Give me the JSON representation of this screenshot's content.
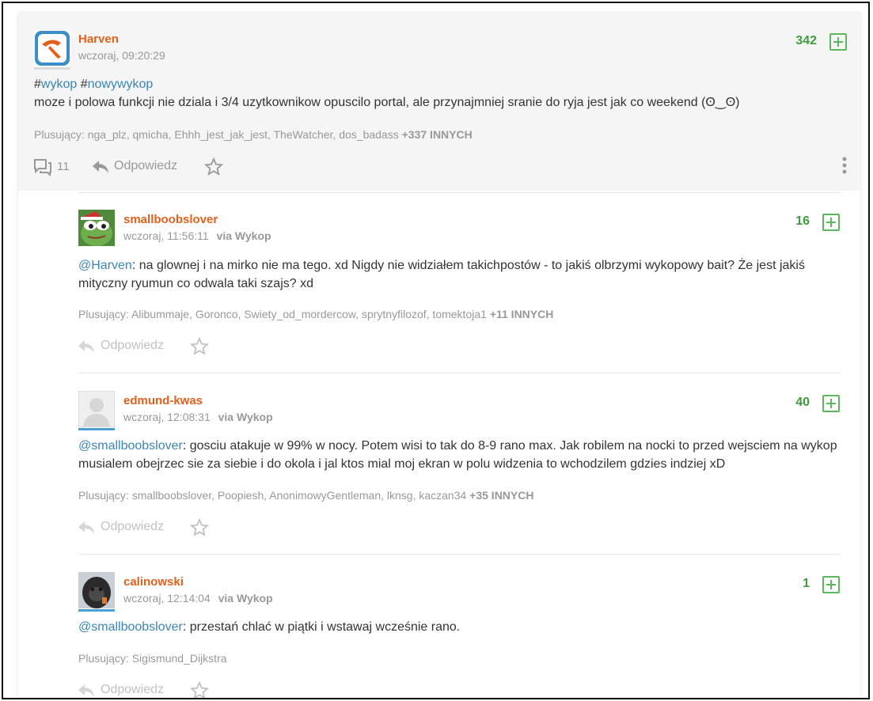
{
  "colors": {
    "username": "#e3601c",
    "link": "#3a86b8",
    "score": "#3e9d3e",
    "muted": "#999999"
  },
  "main": {
    "username": "Harven",
    "time": "wczoraj, 09:20:29",
    "score": "342",
    "tag1_hash": "#",
    "tag1": "wykop",
    "tag2_hash": "#",
    "tag2": "nowywykop",
    "text": "moze i polowa funkcji nie dziala i 3/4 uzytkownikow opuscilo portal, ale przynajmniej sranie do ryja jest jak co weekend (ʘ‿ʘ)",
    "voters_label": "Plusujący:",
    "voters": "nga_plz, qmicha, Ehhh_jest_jak_jest, TheWatcher, dos_badass",
    "voters_more": "+337 INNYCH",
    "comments_count": "11",
    "reply_label": "Odpowiedz",
    "avatar_icon": "wykop-logo-icon"
  },
  "comments": [
    {
      "username": "smallboobslover",
      "time": "wczoraj, 11:56:11",
      "via_label": "via",
      "via": "Wykop",
      "score": "16",
      "mention": "@Harven",
      "text": ": na glownej i na mirko nie ma tego. xd Nigdy nie widziałem takichpostów - to jakiś olbrzymi wykopowy bait? Że jest jakiś mityczny ryumun co odwala taki szajs? xd",
      "voters_label": "Plusujący:",
      "voters": "Alibummaje, Goronco, Swiety_od_mordercow, sprytnyfilozof, tomektoja1",
      "voters_more": "+11 INNYCH",
      "reply_label": "Odpowiedz",
      "avatar_icon": "frog-avatar-icon"
    },
    {
      "username": "edmund-kwas",
      "time": "wczoraj, 12:08:31",
      "via_label": "via",
      "via": "Wykop",
      "score": "40",
      "mention": "@smallboobslover",
      "text": ": gosciu atakuje w 99% w nocy. Potem wisi to tak do 8-9 rano max. Jak robilem na nocki to przed wejsciem na wykop musialem obejrzec sie za siebie i do okola i jal ktos mial moj ekran w polu widzenia to wchodzilem gdzies indziej xD",
      "voters_label": "Plusujący:",
      "voters": "smallboobslover, Poopiesh, AnonimowyGentleman, lknsg, kaczan34",
      "voters_more": "+35 INNYCH",
      "reply_label": "Odpowiedz",
      "avatar_icon": "default-user-avatar-icon"
    },
    {
      "username": "calinowski",
      "time": "wczoraj, 12:14:04",
      "via_label": "via",
      "via": "Wykop",
      "score": "1",
      "mention": "@smallboobslover",
      "text": ": przestań chlać w piątki i wstawaj wcześnie rano.",
      "voters_label": "Plusujący:",
      "voters": "Sigismund_Dijkstra",
      "voters_more": "",
      "reply_label": "Odpowiedz",
      "avatar_icon": "gorilla-avatar-icon"
    }
  ]
}
